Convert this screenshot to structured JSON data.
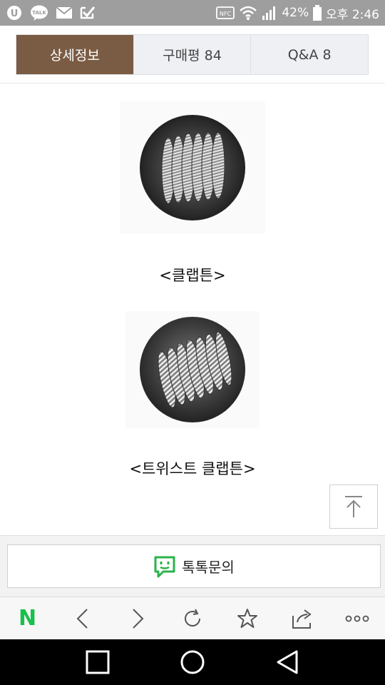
{
  "status_bar": {
    "nfc_label": "NFC",
    "battery_text": "42%",
    "time_text": "오후 2:46",
    "icons": [
      "u-plus-icon",
      "kakao-talk-icon",
      "mail-icon",
      "check-icon",
      "nfc-icon",
      "wifi-icon",
      "signal-icon",
      "battery-icon"
    ]
  },
  "tabs": [
    {
      "label": "상세정보",
      "active": true
    },
    {
      "label": "구매평 84",
      "active": false
    },
    {
      "label": "Q&A 8",
      "active": false
    }
  ],
  "content": {
    "caption_1": "<클랩튼>",
    "caption_2": "<트위스트 클랩튼>"
  },
  "talk_button": {
    "label": "톡톡문의",
    "icon": "talktalk-icon",
    "icon_color": "#2ab34a"
  },
  "browser_bar": {
    "home_label": "N",
    "home_color": "#19c04b",
    "icons": [
      "naver-home-icon",
      "back-icon",
      "forward-icon",
      "refresh-icon",
      "bookmark-star-icon",
      "share-icon",
      "more-icon"
    ]
  },
  "colors": {
    "active_tab": "#7a5c44",
    "inactive_tab": "#eef0f4",
    "status_bar": "#9e9e9e"
  }
}
